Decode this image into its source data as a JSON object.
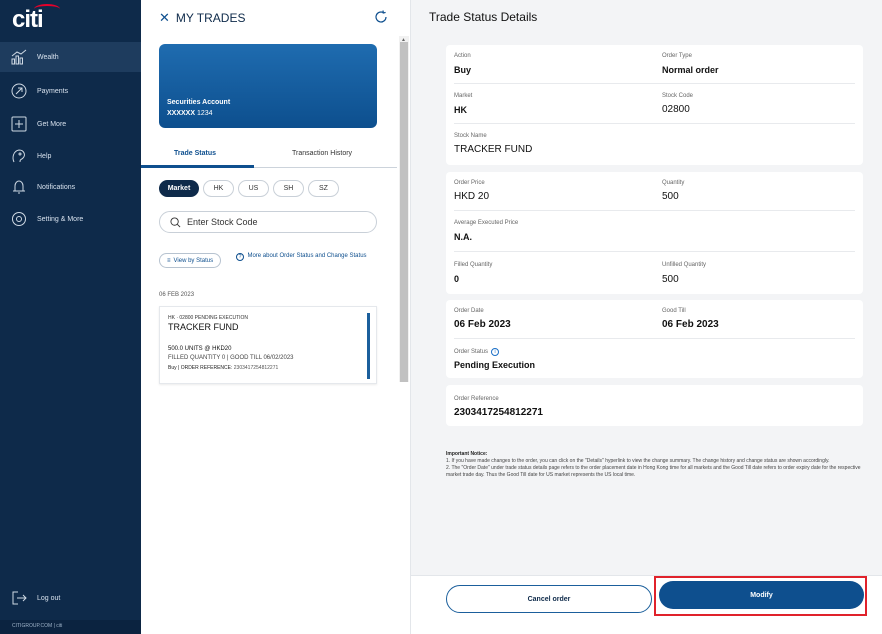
{
  "sidebar": {
    "logo": "citi",
    "items": [
      {
        "label": "Wealth",
        "icon": "wealth-chart-icon",
        "active": true
      },
      {
        "label": "Payments",
        "icon": "payments-arrow-icon"
      },
      {
        "label": "Get More",
        "icon": "get-more-plus-icon"
      },
      {
        "label": "Help",
        "icon": "help-icon"
      },
      {
        "label": "Notifications",
        "icon": "bell-icon"
      },
      {
        "label": "Setting & More",
        "icon": "settings-gear-icon"
      }
    ],
    "logout": "Log out",
    "footer": "CITIGROUP.COM | citi"
  },
  "middle": {
    "header": "MY TRADES",
    "account": {
      "title": "Securities Account",
      "masked": "XXXXXX",
      "suffix": "1234"
    },
    "tabs": [
      "Trade Status",
      "Transaction History"
    ],
    "markets": [
      "Market",
      "HK",
      "US",
      "SH",
      "SZ"
    ],
    "search_placeholder": "Enter Stock Code",
    "view_by_status": "View by Status",
    "more_about": "More about Order Status and Change Status",
    "date_group": "06 FEB 2023",
    "trade": {
      "line1": "HK · 02800  PENDING EXECUTION",
      "name": "TRACKER FUND",
      "units": "500.0 UNITS @ HKD20",
      "filled": "FILLED QUANTITY 0 | GOOD TILL 06/02/2023",
      "ref_prefix": "Buy | ORDER REFERENCE: ",
      "ref_value": "2303417254812271"
    }
  },
  "details": {
    "title": "Trade Status Details",
    "action_label": "Action",
    "action": "Buy",
    "order_type_label": "Order Type",
    "order_type": "Normal order",
    "market_label": "Market",
    "market": "HK",
    "stock_code_label": "Stock Code",
    "stock_code": "02800",
    "stock_name_label": "Stock Name",
    "stock_name": "TRACKER FUND",
    "order_price_label": "Order Price",
    "order_price": "HKD 20",
    "quantity_label": "Quantity",
    "quantity": "500",
    "avg_price_label": "Average Executed Price",
    "avg_price": "N.A.",
    "filled_label": "Filled Quantity",
    "filled": "0",
    "unfilled_label": "Unfilled Quantity",
    "unfilled": "500",
    "order_date_label": "Order Date",
    "order_date": "06 Feb 2023",
    "good_till_label": "Good Till",
    "good_till": "06 Feb 2023",
    "order_status_label": "Order Status",
    "order_status": "Pending Execution",
    "order_ref_label": "Order Reference",
    "order_ref": "2303417254812271"
  },
  "notice": {
    "title": "Important Notice:",
    "p1": "1. If you have made changes to the order, you can click on the \"Details\" hyperlink to view the change summary. The change history and change status are shown accordingly.",
    "p2": "2. The \"Order Date\" under trade status details page refers to the order placement date in Hong Kong time for all markets and the Good Till date refers to order expiry date for the respective market trade day. Thus the Good Till date for US market represents the US local time."
  },
  "actions": {
    "cancel": "Cancel order",
    "modify": "Modify"
  },
  "colors": {
    "sidebar": "#0e2a4a",
    "primary": "#0e4f8e",
    "highlight": "#e0222b"
  }
}
